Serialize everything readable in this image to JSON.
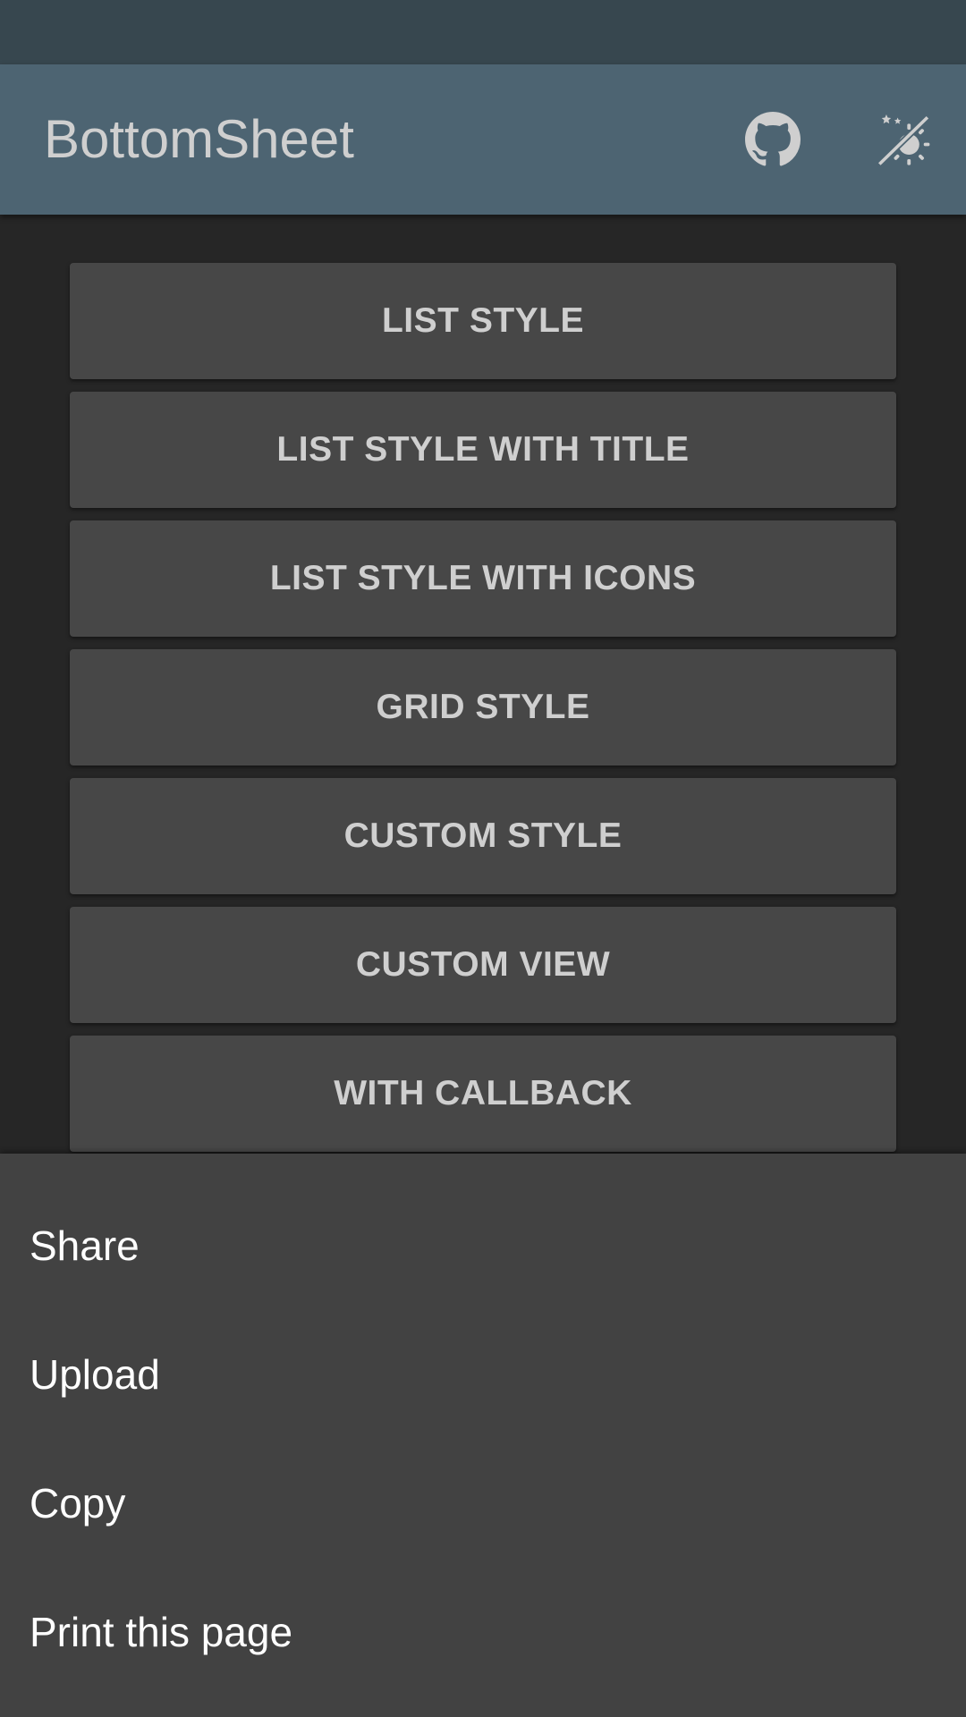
{
  "app_bar": {
    "title": "BottomSheet",
    "actions": [
      {
        "icon": "github-icon",
        "label": "GitHub"
      },
      {
        "icon": "night-mode-icon",
        "label": "Toggle theme"
      }
    ]
  },
  "buttons": [
    {
      "label": "LIST STYLE"
    },
    {
      "label": "LIST STYLE WITH TITLE"
    },
    {
      "label": "LIST STYLE WITH ICONS"
    },
    {
      "label": "GRID STYLE"
    },
    {
      "label": "CUSTOM STYLE"
    },
    {
      "label": "CUSTOM VIEW"
    },
    {
      "label": "WITH CALLBACK"
    }
  ],
  "bottom_sheet": {
    "items": [
      {
        "label": "Share"
      },
      {
        "label": "Upload"
      },
      {
        "label": "Copy"
      },
      {
        "label": "Print this page"
      }
    ]
  },
  "colors": {
    "status_bar": "#37474F",
    "app_bar": "#4D6472",
    "background": "#262626",
    "button": "#474747",
    "sheet": "#424242",
    "button_text": "#CFCFCF",
    "sheet_text": "#FFFFFF"
  }
}
